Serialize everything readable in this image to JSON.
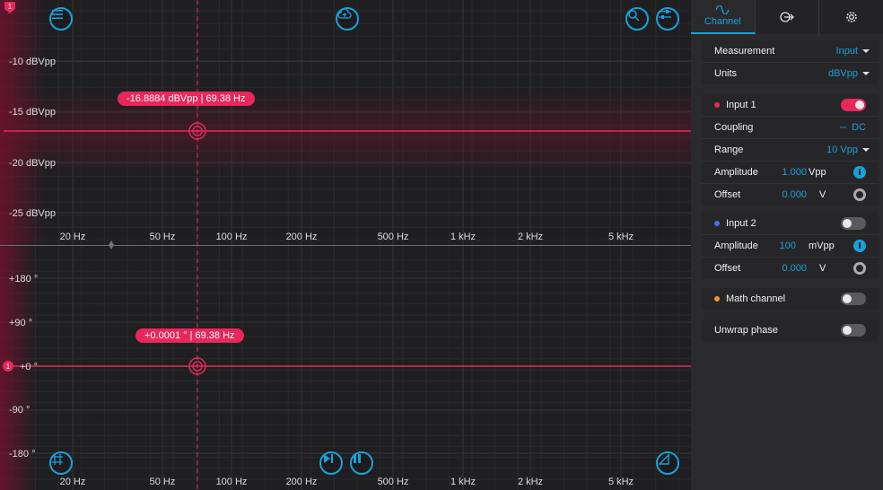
{
  "magnitude": {
    "y_labels": [
      "-10 dBVpp",
      "-15 dBVpp",
      "-20 dBVpp",
      "-25 dBVpp"
    ],
    "x_labels": [
      "20 Hz",
      "50 Hz",
      "100 Hz",
      "200 Hz",
      "500 Hz",
      "1 kHz",
      "2 kHz",
      "5 kHz"
    ],
    "cursor_readout": "-16.8884 dBVpp | 69.38 Hz"
  },
  "phase": {
    "y_labels": [
      "+180 °",
      "+90 °",
      "+0 °",
      "-90 °",
      "-180 °"
    ],
    "x_labels": [
      "20 Hz",
      "50 Hz",
      "100 Hz",
      "200 Hz",
      "500 Hz",
      "1 kHz",
      "2 kHz",
      "5 kHz"
    ],
    "cursor_readout": "+0.0001 ° | 69.38 Hz",
    "channel_marker": "1"
  },
  "top_marker": "1",
  "icons": {
    "menu": "menu-icon",
    "cloud": "cloud-upload-icon",
    "zoom": "zoom-icon",
    "sliders": "sliders-icon",
    "grid": "grid-icon",
    "step": "step-play-icon",
    "pause": "pause-icon",
    "cursor": "cursor-icon"
  },
  "tabs": {
    "channel": "Channel"
  },
  "panel": {
    "measurement": {
      "label": "Measurement",
      "value": "Input"
    },
    "units": {
      "label": "Units",
      "value": "dBVpp"
    },
    "input1": {
      "title": "Input 1",
      "coupling_label": "Coupling",
      "coupling_value": "DC",
      "range_label": "Range",
      "range_value": "10 Vpp",
      "amplitude_label": "Amplitude",
      "amplitude_value": "1.000",
      "amplitude_unit": "Vpp",
      "offset_label": "Offset",
      "offset_value": "0.000",
      "offset_unit": "V"
    },
    "input2": {
      "title": "Input 2",
      "amplitude_label": "Amplitude",
      "amplitude_value": "100",
      "amplitude_unit": "mVpp",
      "offset_label": "Offset",
      "offset_value": "0.000",
      "offset_unit": "V"
    },
    "math": {
      "title": "Math channel"
    },
    "unwrap": {
      "title": "Unwrap phase"
    }
  },
  "colors": {
    "accent": "#1aa0d8",
    "trace": "#e8275a",
    "input2": "#4a6cf0",
    "math": "#f0922a"
  }
}
